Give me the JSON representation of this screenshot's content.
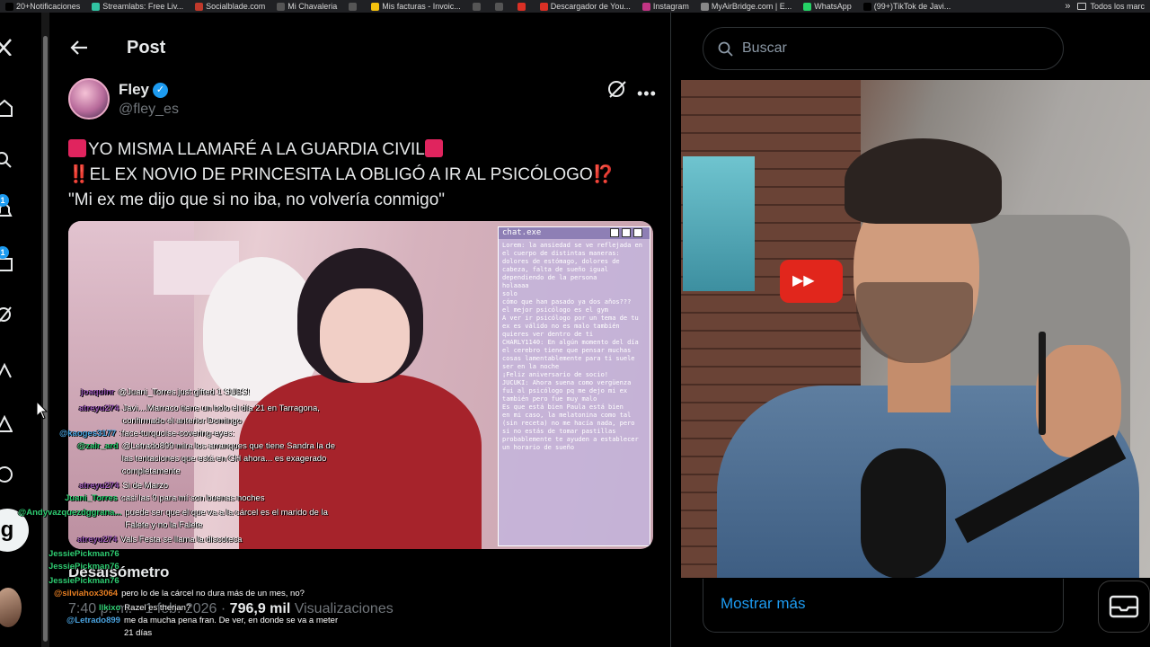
{
  "bookmarks": [
    {
      "label": "20+Notificaciones",
      "icon": "x-logo-icon",
      "color": "#000000"
    },
    {
      "label": "Streamlabs: Free Liv...",
      "icon": "streamlabs-icon",
      "color": "#31c3a2"
    },
    {
      "label": "Socialblade.com",
      "icon": "socialblade-icon",
      "color": "#c0392b"
    },
    {
      "label": "Mi Chavaleria",
      "icon": "globe-icon",
      "color": "#555555"
    },
    {
      "label": "",
      "icon": "globe-icon",
      "color": "#555555"
    },
    {
      "label": "Mis facturas - Invoic...",
      "icon": "invoice-icon",
      "color": "#f4c20d"
    },
    {
      "label": "",
      "icon": "globe-icon",
      "color": "#555555"
    },
    {
      "label": "",
      "icon": "globe-icon",
      "color": "#555555"
    },
    {
      "label": "",
      "icon": "apple-icon",
      "color": "#d93025"
    },
    {
      "label": "Descargador de You...",
      "icon": "youtube-icon",
      "color": "#d93025"
    },
    {
      "label": "Instagram",
      "icon": "instagram-icon",
      "color": "#c13584"
    },
    {
      "label": "MyAirBridge.com | E...",
      "icon": "cloud-icon",
      "color": "#888888"
    },
    {
      "label": "WhatsApp",
      "icon": "whatsapp-icon",
      "color": "#25d366"
    },
    {
      "label": "(99+)TikTok de Javi...",
      "icon": "tiktok-icon",
      "color": "#000000"
    }
  ],
  "bookmarks_more": "»",
  "bookmarks_folder": "Todos los marc",
  "nav": {
    "badge_1": "1",
    "badge_2": "1",
    "grok_label": "g"
  },
  "header": {
    "title": "Post"
  },
  "post": {
    "author_name": "Fley",
    "author_handle": "@fley_es",
    "line1": "YO MISMA LLAMARÉ A LA GUARDIA CIVIL",
    "line2": "EL EX NOVIO DE PRINCESITA LA OBLIGÓ A IR AL PSICÓLOGO",
    "line3": "\"Mi ex me dijo que si no iba, no volvería conmigo\"",
    "bang": "‼️",
    "interrobang": "⁉️",
    "overlay_name": "Desalsómetro",
    "time": "7:40 p. m. · 1 feb. 2026 ·",
    "views_num": "796,9 mil",
    "views_label": "Visualizaciones"
  },
  "media_chat": {
    "title": "chat.exe",
    "lines": [
      "Lorem: la ansiedad se ve reflejada en el cuerpo de distintas maneras: dolores de estómago, dolores de cabeza, falta de sueño igual dependiendo de la persona",
      "holaaaa",
      "solo",
      "cómo que han pasado ya dos años???",
      "el mejor psicólogo es el gym",
      "A ver ir psicólogo por un tema de tu ex es válido no es malo también quieres ver dentro de ti",
      "CHARLY1140: En algún momento del día el cerebro tiene que pensar muchas cosas lamentablemente para ti suele ser en la noche",
      "¡Feliz aniversario de socio!",
      "JUCUKI: Ahora suena como vergüenza",
      "fui al psicólogo pq me dejo mi ex también pero fue muy malo",
      "Es que está bien Paula está bien",
      "en mi caso, la melatonina como tal (sin receta) no me hacía nada, pero si no estás de tomar pastillas probablemente te ayuden a establecer un horario de sueño"
    ]
  },
  "stream_chat": [
    {
      "user": "joaquinr",
      "text": "@Juani_Torres just gifted 1 SUBS!",
      "color": "#9b59b6"
    },
    {
      "user": "atreyu274",
      "text": "Javi....Marraco tiene un bolo el día 21 en Tarragona, confirmado el anterior Domingo",
      "color": "#9b59b6"
    },
    {
      "user": "@kaoges3177",
      "text": ":face-turquoise-covering-eyes:",
      "color": "#4aa3df"
    },
    {
      "user": "@zair_ard",
      "text": "@Letrado899 mira los arranques que tiene Sandra la de las tentaciones que está en GH ahora... es exagerado completamente",
      "color": "#2ecc71"
    },
    {
      "user": "atreyu274",
      "text": "Si de Marzo",
      "color": "#9b59b6"
    },
    {
      "user": "Juani_Torres",
      "text": "casi las 9 para mí son buenas noches",
      "color": "#2ecc71"
    },
    {
      "user": "@Andyvazquezdggrana...",
      "text": "puede ser que el que va a la cárcel es el marido de la Falete y no la Falete",
      "color": "#2ecc71"
    },
    {
      "user": "atreyu274",
      "text": "Vals Festa se llama la discoteca",
      "color": "#9b59b6"
    },
    {
      "user": "JessiePickman76",
      "text": "",
      "color": "#2ecc71"
    },
    {
      "user": "JessiePickman76",
      "text": "",
      "color": "#2ecc71"
    },
    {
      "user": "JessiePickman76",
      "text": "",
      "color": "#2ecc71"
    },
    {
      "user": "@silviahox3064",
      "text": "pero lo de la cárcel no dura más de un mes, no?",
      "color": "#e67e22"
    },
    {
      "user": "likixo",
      "text": "Razel es therian?",
      "color": "#2ecc71"
    },
    {
      "user": "@Letrado899",
      "text": "me da mucha pena fran. De ver, en donde se va a meter 21 días",
      "color": "#4aa3df"
    }
  ],
  "right": {
    "search_placeholder": "Buscar",
    "show_more": "Mostrar más"
  },
  "colors": {
    "accent": "#1d9bf0",
    "background": "#000000",
    "border": "#2f3336",
    "muted": "#71767b"
  }
}
